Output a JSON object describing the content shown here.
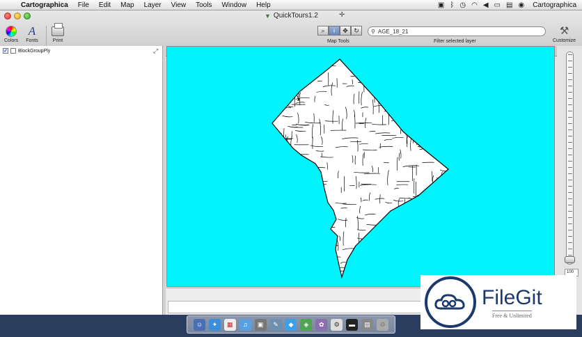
{
  "menubar": {
    "app_name": "Cartographica",
    "items": [
      "File",
      "Edit",
      "Map",
      "Layer",
      "View",
      "Tools",
      "Window",
      "Help"
    ],
    "status_app": "Cartographica"
  },
  "window": {
    "title": "QuickTours1.2"
  },
  "toolbar": {
    "colors_label": "Colors",
    "fonts_label": "Fonts",
    "print_label": "Print",
    "map_tools_label": "Map Tools",
    "filter_value": "AGE_18_21",
    "filter_label": "Filter selected layer",
    "customize_label": "Customize"
  },
  "layers": [
    {
      "name": "BlockGroupPly",
      "visible": true
    }
  ],
  "zoom": {
    "value": "100"
  },
  "watermark": {
    "brand": "FileGit",
    "tagline": "Free & Unlimited"
  },
  "colors": {
    "map_background": "#00f4fb",
    "brand": "#1b3a6b"
  }
}
